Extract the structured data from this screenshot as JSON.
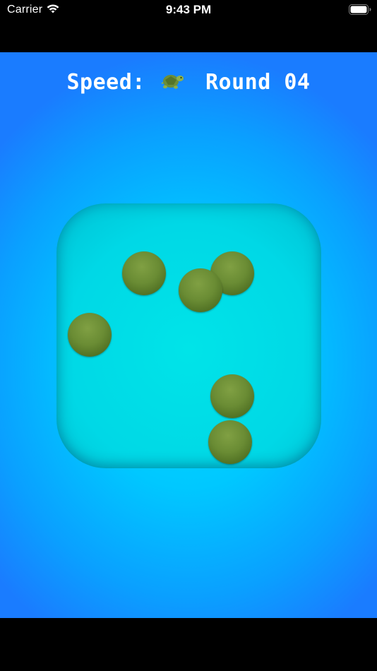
{
  "status_bar": {
    "carrier": "Carrier",
    "time": "9:43 PM",
    "wifi_icon": "wifi-icon",
    "battery_icon": "battery-icon"
  },
  "hud": {
    "speed_label": "Speed:",
    "speed_icon": "turtle-icon",
    "round_label": "Round 04"
  },
  "board": {
    "ball_count": 6,
    "ball_color": "#6a8c34",
    "board_color": "#00d8e6",
    "background_color": "#00c8ff"
  }
}
